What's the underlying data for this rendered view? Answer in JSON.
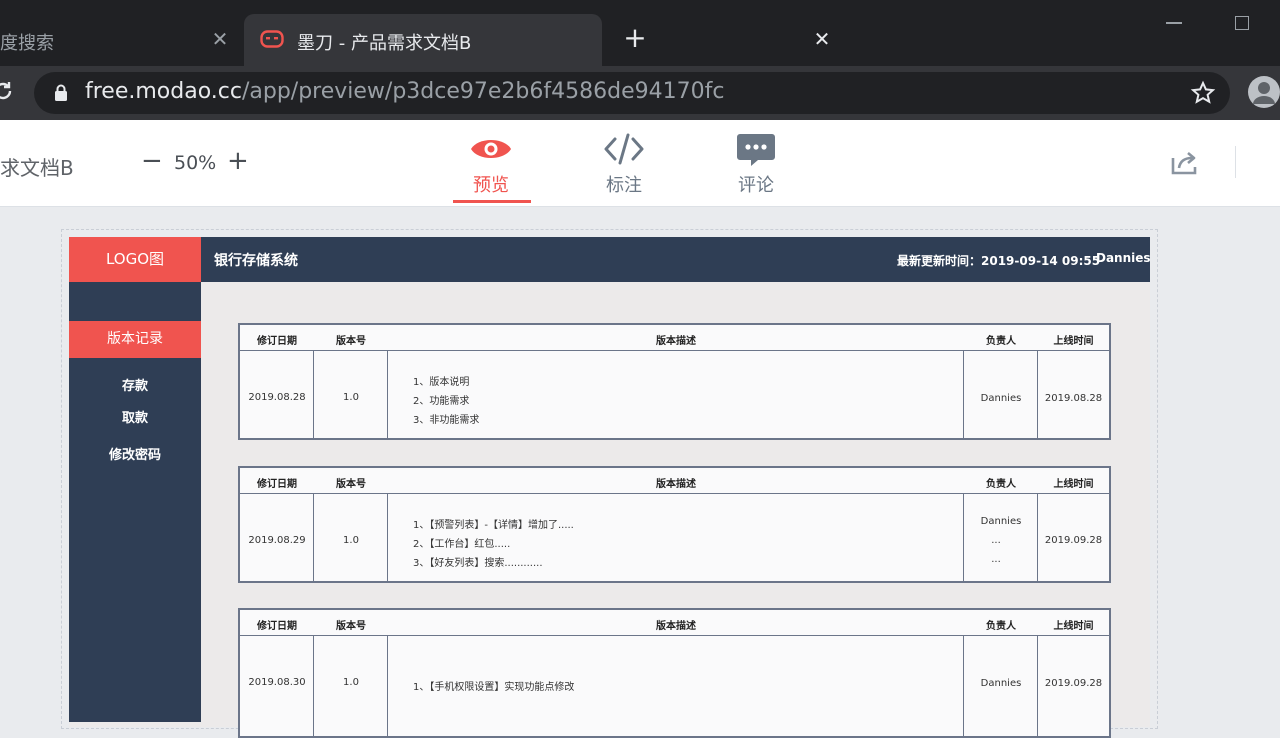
{
  "browser": {
    "tabs": [
      {
        "title": "度搜索",
        "close": "✕"
      },
      {
        "title": "墨刀 - 产品需求文档B",
        "close": "✕"
      }
    ],
    "new_tab": "+",
    "url_host": "free.modao.cc",
    "url_path": "/app/preview/p3dce97e2b6f4586de94170fc"
  },
  "toolbar": {
    "project_name": "求文档B",
    "zoom_minus": "−",
    "zoom": "50%",
    "zoom_plus": "+",
    "modes": [
      {
        "label": "预览",
        "icon": "eye-icon",
        "active": true
      },
      {
        "label": "标注",
        "icon": "code-icon",
        "active": false
      },
      {
        "label": "评论",
        "icon": "comment-icon",
        "active": false
      }
    ],
    "accent_color": "#f0544f"
  },
  "prototype": {
    "logo": "LOGO图",
    "system_title": "银行存储系统",
    "updated": "最新更新时间：2019-09-14 09:55",
    "user": "Dannies",
    "sidebar": {
      "active": "版本记录",
      "items": [
        "存款",
        "取款",
        "修改密码"
      ]
    },
    "table_headers": [
      "修订日期",
      "版本号",
      "版本描述",
      "负责人",
      "上线时间"
    ],
    "records": [
      {
        "date": "2019.08.28",
        "version": "1.0",
        "desc": [
          "1、版本说明",
          "2、功能需求",
          "3、非功能需求"
        ],
        "owner": [
          "Dannies"
        ],
        "online": "2019.08.28"
      },
      {
        "date": "2019.08.29",
        "version": "1.0",
        "desc": [
          "1、【预警列表】-【详情】增加了.....",
          "2、【工作台】红包.....",
          "3、【好友列表】搜索............"
        ],
        "owner": [
          "Dannies",
          "...",
          "..."
        ],
        "online": "2019.09.28"
      },
      {
        "date": "2019.08.30",
        "version": "1.0",
        "desc": [
          "1、【手机权限设置】实现功能点修改"
        ],
        "owner": [
          "Dannies"
        ],
        "online": "2019.09.28"
      }
    ]
  }
}
